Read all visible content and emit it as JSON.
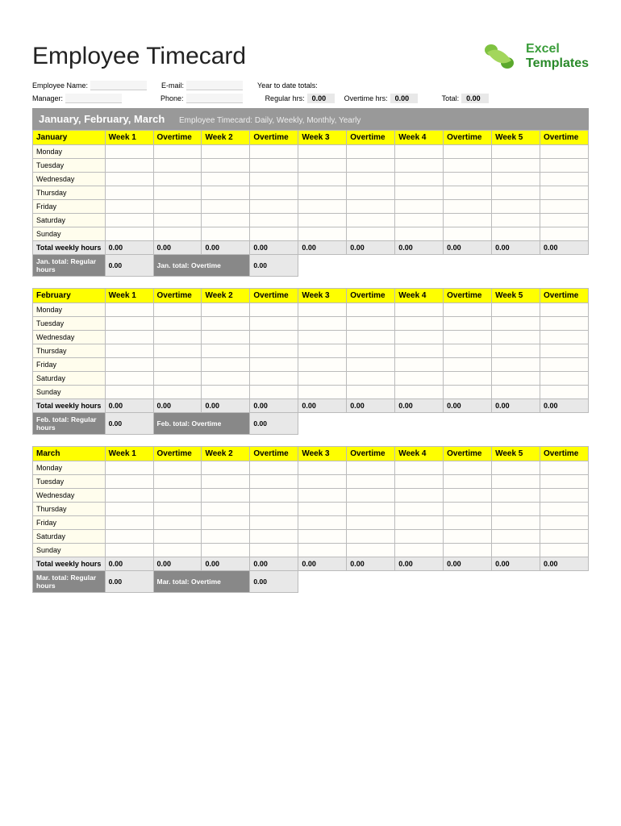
{
  "title": "Employee Timecard",
  "logo": {
    "line1": "Excel",
    "line2": "Templates"
  },
  "info": {
    "emp_name_lbl": "Employee Name:",
    "email_lbl": "E-mail:",
    "ytd_lbl": "Year to date totals:",
    "manager_lbl": "Manager:",
    "phone_lbl": "Phone:",
    "reg_hrs_lbl": "Regular hrs:",
    "reg_hrs_val": "0.00",
    "ot_hrs_lbl": "Overtime hrs:",
    "ot_hrs_val": "0.00",
    "total_lbl": "Total:",
    "total_val": "0.00"
  },
  "quarter_title": "January, February, March",
  "quarter_sub": "Employee Timecard: Daily, Weekly, Monthly, Yearly",
  "headers": [
    "Week 1",
    "Overtime",
    "Week 2",
    "Overtime",
    "Week 3",
    "Overtime",
    "Week 4",
    "Overtime",
    "Week 5",
    "Overtime"
  ],
  "days": [
    "Monday",
    "Tuesday",
    "Wednesday",
    "Thursday",
    "Friday",
    "Saturday",
    "Sunday"
  ],
  "total_weekly_lbl": "Total weekly hours",
  "months": [
    {
      "name": "January",
      "weekly_totals": [
        "0.00",
        "0.00",
        "0.00",
        "0.00",
        "0.00",
        "0.00",
        "0.00",
        "0.00",
        "0.00",
        "0.00"
      ],
      "reg_total_lbl": "Jan. total: Regular hours",
      "reg_total_val": "0.00",
      "ot_total_lbl": "Jan. total: Overtime",
      "ot_total_val": "0.00"
    },
    {
      "name": "February",
      "weekly_totals": [
        "0.00",
        "0.00",
        "0.00",
        "0.00",
        "0.00",
        "0.00",
        "0.00",
        "0.00",
        "0.00",
        "0.00"
      ],
      "reg_total_lbl": "Feb. total: Regular hours",
      "reg_total_val": "0.00",
      "ot_total_lbl": "Feb.  total: Overtime",
      "ot_total_val": "0.00"
    },
    {
      "name": "March",
      "weekly_totals": [
        "0.00",
        "0.00",
        "0.00",
        "0.00",
        "0.00",
        "0.00",
        "0.00",
        "0.00",
        "0.00",
        "0.00"
      ],
      "reg_total_lbl": "Mar. total: Regular hours",
      "reg_total_val": "0.00",
      "ot_total_lbl": "Mar. total: Overtime",
      "ot_total_val": "0.00"
    }
  ]
}
